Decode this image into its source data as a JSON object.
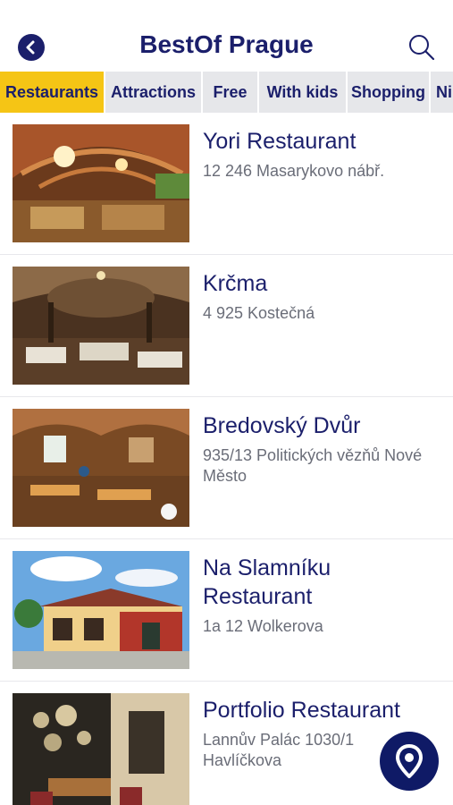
{
  "header": {
    "title": "BestOf Prague",
    "back_icon": "chevron-left-icon",
    "search_icon": "search-icon"
  },
  "tabs": [
    {
      "label": "Restaurants",
      "active": true
    },
    {
      "label": "Attractions",
      "active": false
    },
    {
      "label": "Free",
      "active": false
    },
    {
      "label": "With kids",
      "active": false
    },
    {
      "label": "Shopping",
      "active": false
    },
    {
      "label": "Ni",
      "active": false
    }
  ],
  "places": [
    {
      "name": "Yori Restaurant",
      "address": "12 246 Masarykovo nábř."
    },
    {
      "name": "Krčma",
      "address": "4 925 Kostečná"
    },
    {
      "name": "Bredovský Dvůr",
      "address": "935/13 Politických vězňů Nové Město"
    },
    {
      "name": "Na Slamníku Restaurant",
      "address": "1a 12 Wolkerova"
    },
    {
      "name": "Portfolio Restaurant",
      "address": "Lannův Palác 1030/1 Havlíčkova"
    }
  ],
  "map_button": {
    "icon": "map-pin-icon"
  },
  "colors": {
    "accent": "#f5c515",
    "brand": "#1b1f6b",
    "tab_bg": "#e6e7ea"
  }
}
